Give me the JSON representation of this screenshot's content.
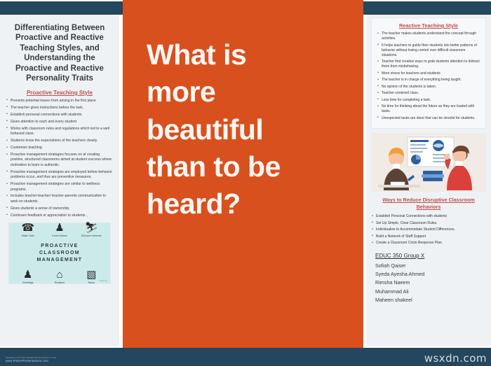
{
  "poster": {
    "title": "Differentiating Between Proactive and Reactive Teaching Styles, and Understanding the Proactive and Reactive Personality Traits",
    "accent_orange": "#d9501f",
    "accent_navy": "#24465e",
    "heading_red": "#c0504d",
    "panel_bg": "#eef2f5"
  },
  "center": {
    "line1": "What is",
    "line2": "more",
    "line3": "beautiful",
    "line4": "than to be",
    "line5": "heard?"
  },
  "left": {
    "section_heading": "Proactive Teaching Style",
    "bullets": [
      "Prevents potential issues from arising in the first place",
      "The teacher gives instructions before the task.",
      "Establish personal connections with students.",
      "Gives attention to each and every student",
      "Works with classroom rules and regulations which led to a well behaved class.",
      "Students know the expectations of the teachers clearly.",
      "Customize teaching",
      "Proactive management strategies focuses on at creating positive, structured classrooms aimed at student success where motivation to learn is authentic.",
      "Proactive management strategies are employed before behavior problems occur, and thus are preventive measures.",
      "Proactive management strategies are similar to wellness programs.",
      "Includes teacher-teacher/ teacher-parents communication to work on students.",
      "Gives students a sense of ownership.",
      "Continues feedback or appreciation to students. ,"
    ],
    "infographic": {
      "title_line1": "PROACTIVE",
      "title_line2": "CLASSROOM",
      "title_line3": "MANAGEMENT",
      "top_items": [
        {
          "icon": "phone-icon",
          "glyph": "☎",
          "label": "Make Calls"
        },
        {
          "icon": "person-icon",
          "glyph": "♟",
          "label": "Know Names"
        },
        {
          "icon": "surfer-icon",
          "glyph": "⛷",
          "label": "Discover Interests"
        }
      ],
      "bottom_items": [
        {
          "icon": "people-icon",
          "glyph": "♟",
          "label": "Greetings"
        },
        {
          "icon": "house-icon",
          "glyph": "⌂",
          "label": "Routines"
        },
        {
          "icon": "document-icon",
          "glyph": "▧",
          "label": "Rules"
        }
      ],
      "credit": "design by"
    }
  },
  "right": {
    "reactive_heading": "Reactive Teaching Style",
    "reactive_bullets": [
      "The teacher makes students understand the concept through activities.",
      "It helps teachers to guide their students into better patterns of behavior without losing control over difficult classroom situations.",
      "Teacher find creative ways to grab students attention to distract them from misbehaving.",
      "More stress for teachers and students",
      "The teacher is in charge of everything being taught.",
      "No opinion of the students is taken.",
      "Teacher-centered class.",
      "Less time for completing a task.",
      "No time for thinking about the future as they are loaded with tasks.",
      "Unexpected tasks are done that can be stresful for students."
    ],
    "ways_heading": "Ways to Reduce Disruptive Classroom Behaviors",
    "ways_bullets": [
      "Establish Personal Connections with students",
      "Set Up Simple, Clear Classroom Rules.",
      "Individualize to Accommodate Student Differences.",
      "Build a Network of Staff Support.",
      "Create a Classroom Crisis Response Plan."
    ],
    "group_heading": "EDUC 350 Group X",
    "members": [
      "Sofiah Qaiser",
      "Syeda Ayesha Ahmed",
      "Rimsha Naeem",
      "Muhammad Ali",
      "Maheen shakeel"
    ]
  },
  "footer": {
    "credit_small": "RESEARCH POSTER PRESENTATION DESIGN © 2019",
    "credit_url": "www.PosterPresentations.com",
    "watermark": "wsxdn.com"
  }
}
